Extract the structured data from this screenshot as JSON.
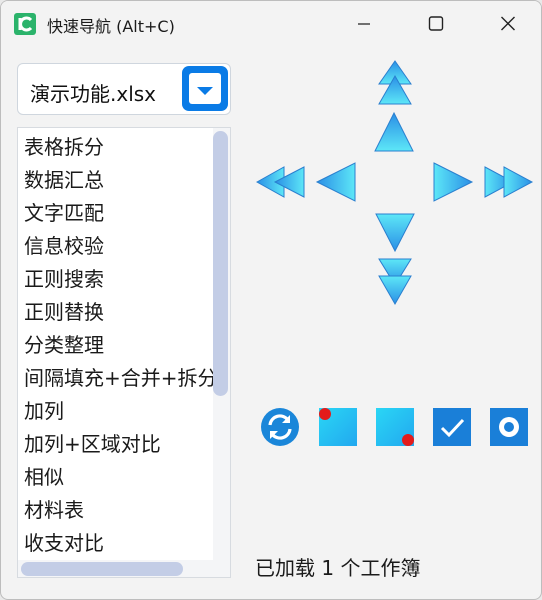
{
  "window": {
    "title": "快速导航 (Alt+C)"
  },
  "workbook_select": {
    "value": "演示功能.xlsx"
  },
  "function_list": {
    "items": [
      "表格拆分",
      "数据汇总",
      "文字匹配",
      "信息校验",
      "正则搜索",
      "正则替换",
      "分类整理",
      "间隔填充+合并+拆分",
      "加列",
      "加列+区域对比",
      "相似",
      "材料表",
      "收支对比"
    ]
  },
  "navigation": {
    "icons": [
      "double-up-arrow-icon",
      "up-arrow-icon",
      "down-arrow-icon",
      "double-down-arrow-icon",
      "double-left-arrow-icon",
      "left-arrow-icon",
      "right-arrow-icon",
      "double-right-arrow-icon"
    ]
  },
  "tools": {
    "icons": [
      "refresh-icon",
      "top-left-corner-icon",
      "bottom-right-corner-icon",
      "checkbox-icon",
      "record-icon"
    ]
  },
  "colors": {
    "accent": "#0a7be6",
    "arrow_light": "#5de7f7",
    "arrow_dark": "#2a8fe6",
    "marker_red": "#e31b1b"
  },
  "status": {
    "text": "已加载 1 个工作簿"
  }
}
